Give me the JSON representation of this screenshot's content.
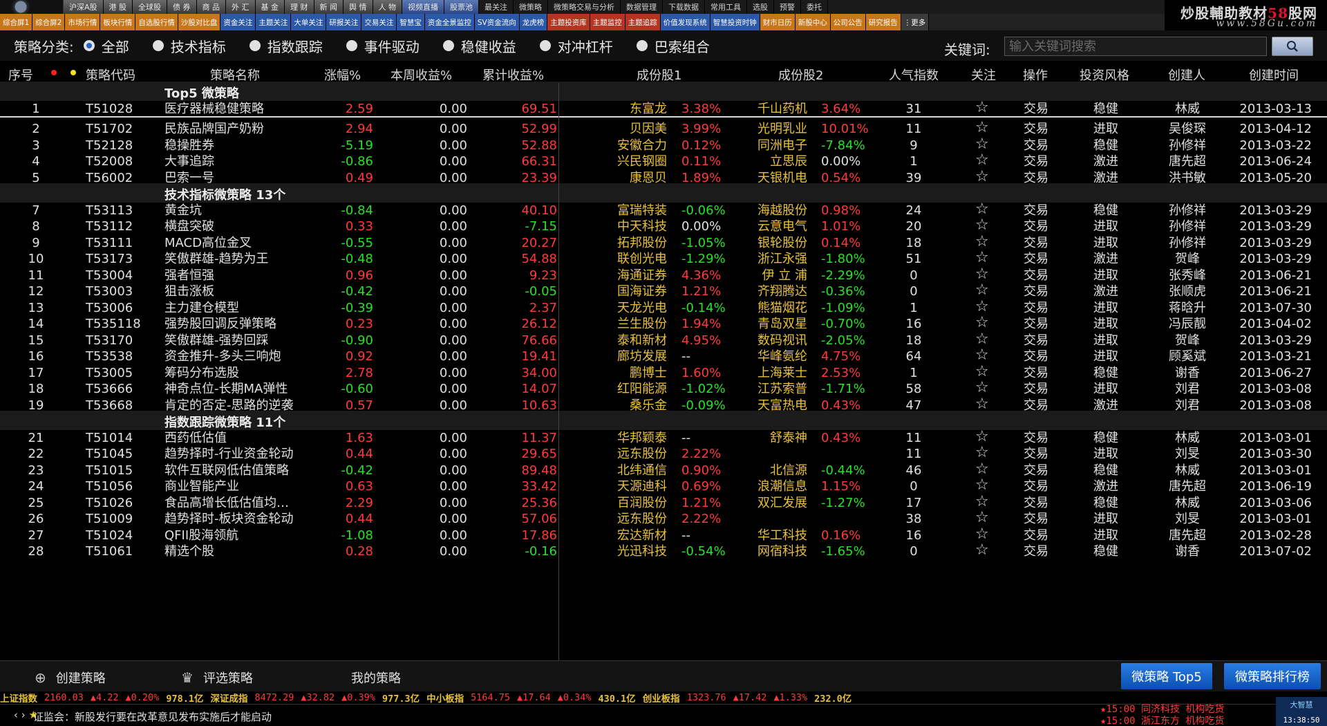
{
  "nav_top": [
    "沪深A股",
    "港 股",
    "全球股",
    "债 券",
    "商 品",
    "外 汇",
    "基 金",
    "理 财",
    "新 闻",
    "舆 情",
    "人 物",
    "视频直播",
    "股票池",
    "最关注",
    "微策略",
    "微策略交易与分析",
    "数据管理",
    "下载数据",
    "常用工具",
    "选股",
    "预警",
    "委托"
  ],
  "nav_second": [
    {
      "label": "综合屏1",
      "color": "or"
    },
    {
      "label": "综合屏2",
      "color": "or"
    },
    {
      "label": "市场行情",
      "color": "or"
    },
    {
      "label": "板块行情",
      "color": "or"
    },
    {
      "label": "自选股行情",
      "color": "or"
    },
    {
      "label": "沙股对比盘",
      "color": "or"
    },
    {
      "label": "资金关注",
      "color": "bl"
    },
    {
      "label": "主题关注",
      "color": "bl"
    },
    {
      "label": "大单关注",
      "color": "bl"
    },
    {
      "label": "研报关注",
      "color": "bl"
    },
    {
      "label": "交易关注",
      "color": "bl"
    },
    {
      "label": "智慧宝",
      "color": "bl"
    },
    {
      "label": "资金全景监控",
      "color": "bl"
    },
    {
      "label": "SV资金流向",
      "color": "bl"
    },
    {
      "label": "龙虎榜",
      "color": "bl"
    },
    {
      "label": "主题投资库",
      "color": "rd"
    },
    {
      "label": "主题监控",
      "color": "rd"
    },
    {
      "label": "主题追踪",
      "color": "rd"
    },
    {
      "label": "价值发现系统",
      "color": "bl"
    },
    {
      "label": "智慧投资时钟",
      "color": "bl"
    },
    {
      "label": "财市日历",
      "color": "or"
    },
    {
      "label": "新股中心",
      "color": "or"
    },
    {
      "label": "公司公告",
      "color": "or"
    },
    {
      "label": "研究报告",
      "color": "or"
    },
    {
      "label": "⋮更多",
      "color": "gy"
    }
  ],
  "brand": {
    "line1a": "炒股輔助教材",
    "line1b": "58",
    "line1c": "股网",
    "line2": "www.58Gu.com"
  },
  "filter": {
    "label": "策略分类:",
    "options": [
      "全部",
      "技术指标",
      "指数跟踪",
      "事件驱动",
      "稳健收益",
      "对冲杠杆",
      "巴索组合"
    ],
    "selected_index": 0,
    "keyword_label": "关键词:",
    "keyword_placeholder": "输入关键词搜索"
  },
  "columns": {
    "seq": "序号",
    "code": "策略代码",
    "name": "策略名称",
    "chg": "涨幅%",
    "week": "本周收益%",
    "total": "累计收益%",
    "stock1": "成份股1",
    "stock2": "成份股2",
    "pop": "人气指数",
    "follow": "关注",
    "op": "操作",
    "style": "投资风格",
    "creator": "创建人",
    "time": "创建时间"
  },
  "groups": [
    {
      "title": "Top5 微策略",
      "rows": [
        {
          "seq": "1",
          "code": "T51028",
          "name": "医疗器械稳健策略",
          "chg": "2.59",
          "week": "0.00",
          "total": "69.51",
          "s1": "东富龙",
          "s1p": "3.38%",
          "s2": "千山药机",
          "s2p": "3.64%",
          "pop": "31",
          "op": "交易",
          "style": "稳健",
          "creator": "林威",
          "time": "2013-03-13"
        },
        {
          "seq": "2",
          "code": "T51702",
          "name": "民族品牌国产奶粉",
          "chg": "2.94",
          "week": "0.00",
          "total": "52.99",
          "s1": "贝因美",
          "s1p": "3.99%",
          "s2": "光明乳业",
          "s2p": "10.01%",
          "pop": "11",
          "op": "交易",
          "style": "进取",
          "creator": "吴俊琛",
          "time": "2013-04-12"
        },
        {
          "seq": "3",
          "code": "T52128",
          "name": "稳操胜券",
          "chg": "-5.19",
          "week": "0.00",
          "total": "52.88",
          "s1": "安徽合力",
          "s1p": "0.12%",
          "s2": "同洲电子",
          "s2p": "-7.84%",
          "pop": "9",
          "op": "交易",
          "style": "稳健",
          "creator": "孙修祥",
          "time": "2013-03-22"
        },
        {
          "seq": "4",
          "code": "T52008",
          "name": "大事追踪",
          "chg": "-0.86",
          "week": "0.00",
          "total": "66.31",
          "s1": "兴民钢圈",
          "s1p": "0.11%",
          "s2": "立思辰",
          "s2p": "0.00%",
          "pop": "1",
          "op": "交易",
          "style": "激进",
          "creator": "唐先超",
          "time": "2013-06-24"
        },
        {
          "seq": "5",
          "code": "T56002",
          "name": "巴索一号",
          "chg": "0.49",
          "week": "0.00",
          "total": "23.39",
          "s1": "康恩贝",
          "s1p": "1.89%",
          "s2": "天银机电",
          "s2p": "0.54%",
          "pop": "39",
          "op": "交易",
          "style": "激进",
          "creator": "洪书敏",
          "time": "2013-05-20"
        }
      ]
    },
    {
      "title": "技术指标微策略 13个",
      "rows": [
        {
          "seq": "7",
          "code": "T53113",
          "name": "黄金坑",
          "chg": "-0.84",
          "week": "0.00",
          "total": "40.10",
          "s1": "富瑞特装",
          "s1p": "-0.06%",
          "s2": "海越股份",
          "s2p": "0.98%",
          "pop": "24",
          "op": "交易",
          "style": "稳健",
          "creator": "孙修祥",
          "time": "2013-03-29"
        },
        {
          "seq": "8",
          "code": "T53112",
          "name": "横盘突破",
          "chg": "0.33",
          "week": "0.00",
          "total": "-7.15",
          "s1": "中天科技",
          "s1p": "0.00%",
          "s2": "云意电气",
          "s2p": "1.01%",
          "pop": "20",
          "op": "交易",
          "style": "进取",
          "creator": "孙修祥",
          "time": "2013-03-29"
        },
        {
          "seq": "9",
          "code": "T53111",
          "name": "MACD高位金叉",
          "chg": "-0.55",
          "week": "0.00",
          "total": "20.27",
          "s1": "拓邦股份",
          "s1p": "-1.05%",
          "s2": "银轮股份",
          "s2p": "0.14%",
          "pop": "18",
          "op": "交易",
          "style": "进取",
          "creator": "孙修祥",
          "time": "2013-03-29"
        },
        {
          "seq": "10",
          "code": "T53173",
          "name": "笑傲群雄-趋势为王",
          "chg": "-0.48",
          "week": "0.00",
          "total": "54.88",
          "s1": "联创光电",
          "s1p": "-1.29%",
          "s2": "浙江永强",
          "s2p": "-1.80%",
          "pop": "51",
          "op": "交易",
          "style": "激进",
          "creator": "贺峰",
          "time": "2013-03-29"
        },
        {
          "seq": "11",
          "code": "T53004",
          "name": "强者恒强",
          "chg": "0.96",
          "week": "0.00",
          "total": "9.23",
          "s1": "海通证券",
          "s1p": "4.36%",
          "s2": "伊 立 浦",
          "s2p": "-2.29%",
          "pop": "0",
          "op": "交易",
          "style": "进取",
          "creator": "张秀峰",
          "time": "2013-06-21"
        },
        {
          "seq": "12",
          "code": "T53003",
          "name": "狙击涨板",
          "chg": "-0.42",
          "week": "0.00",
          "total": "-0.05",
          "s1": "国海证券",
          "s1p": "1.21%",
          "s2": "齐翔腾达",
          "s2p": "-0.36%",
          "pop": "0",
          "op": "交易",
          "style": "激进",
          "creator": "张顺虎",
          "time": "2013-06-21"
        },
        {
          "seq": "13",
          "code": "T53006",
          "name": "主力建仓模型",
          "chg": "-0.39",
          "week": "0.00",
          "total": "2.37",
          "s1": "天龙光电",
          "s1p": "-0.14%",
          "s2": "熊猫烟花",
          "s2p": "-1.09%",
          "pop": "1",
          "op": "交易",
          "style": "进取",
          "creator": "蒋晗升",
          "time": "2013-07-30"
        },
        {
          "seq": "14",
          "code": "T535118",
          "name": "强势股回调反弹策略",
          "chg": "0.23",
          "week": "0.00",
          "total": "26.12",
          "s1": "兰生股份",
          "s1p": "1.94%",
          "s2": "青岛双星",
          "s2p": "-0.70%",
          "pop": "16",
          "op": "交易",
          "style": "进取",
          "creator": "冯辰靓",
          "time": "2013-04-02"
        },
        {
          "seq": "15",
          "code": "T53170",
          "name": "笑傲群雄-强势回踩",
          "chg": "-0.90",
          "week": "0.00",
          "total": "76.66",
          "s1": "泰和新材",
          "s1p": "4.95%",
          "s2": "数码视讯",
          "s2p": "-2.05%",
          "pop": "18",
          "op": "交易",
          "style": "进取",
          "creator": "贺峰",
          "time": "2013-03-29"
        },
        {
          "seq": "16",
          "code": "T53538",
          "name": "资金推升-多头三响炮",
          "chg": "0.92",
          "week": "0.00",
          "total": "19.41",
          "s1": "廊坊发展",
          "s1p": "--",
          "s2": "华峰氨纶",
          "s2p": "4.75%",
          "pop": "64",
          "op": "交易",
          "style": "进取",
          "creator": "顾奚斌",
          "time": "2013-03-21"
        },
        {
          "seq": "17",
          "code": "T53005",
          "name": "筹码分布选股",
          "chg": "2.78",
          "week": "0.00",
          "total": "34.00",
          "s1": "鹏博士",
          "s1p": "1.60%",
          "s2": "上海莱士",
          "s2p": "2.53%",
          "pop": "1",
          "op": "交易",
          "style": "稳健",
          "creator": "谢香",
          "time": "2013-06-27"
        },
        {
          "seq": "18",
          "code": "T53666",
          "name": "神奇点位-长期MA弹性",
          "chg": "-0.60",
          "week": "0.00",
          "total": "14.07",
          "s1": "红阳能源",
          "s1p": "-1.02%",
          "s2": "江苏索普",
          "s2p": "-1.71%",
          "pop": "58",
          "op": "交易",
          "style": "进取",
          "creator": "刘君",
          "time": "2013-03-08"
        },
        {
          "seq": "19",
          "code": "T53668",
          "name": "肯定的否定-思路的逆袭",
          "chg": "0.57",
          "week": "0.00",
          "total": "10.63",
          "s1": "桑乐金",
          "s1p": "-0.09%",
          "s2": "天富热电",
          "s2p": "0.43%",
          "pop": "47",
          "op": "交易",
          "style": "激进",
          "creator": "刘君",
          "time": "2013-03-08"
        }
      ]
    },
    {
      "title": "指数跟踪微策略 11个",
      "rows": [
        {
          "seq": "21",
          "code": "T51014",
          "name": "西药低估值",
          "chg": "1.63",
          "week": "0.00",
          "total": "11.37",
          "s1": "华邦颖泰",
          "s1p": "--",
          "s2": "舒泰神",
          "s2p": "0.43%",
          "pop": "11",
          "op": "交易",
          "style": "稳健",
          "creator": "林威",
          "time": "2013-03-01"
        },
        {
          "seq": "22",
          "code": "T51045",
          "name": "趋势择时-行业资金轮动",
          "chg": "0.44",
          "week": "0.00",
          "total": "29.65",
          "s1": "远东股份",
          "s1p": "2.22%",
          "s2": "",
          "s2p": "",
          "pop": "11",
          "op": "交易",
          "style": "进取",
          "creator": "刘旻",
          "time": "2013-03-30"
        },
        {
          "seq": "23",
          "code": "T51015",
          "name": "软件互联网低估值策略",
          "chg": "-0.42",
          "week": "0.00",
          "total": "89.48",
          "s1": "北纬通信",
          "s1p": "0.90%",
          "s2": "北信源",
          "s2p": "-0.44%",
          "pop": "46",
          "op": "交易",
          "style": "稳健",
          "creator": "林威",
          "time": "2013-03-01"
        },
        {
          "seq": "24",
          "code": "T51056",
          "name": "商业智能产业",
          "chg": "0.63",
          "week": "0.00",
          "total": "33.42",
          "s1": "天源迪科",
          "s1p": "0.69%",
          "s2": "浪潮信息",
          "s2p": "1.15%",
          "pop": "0",
          "op": "交易",
          "style": "激进",
          "creator": "唐先超",
          "time": "2013-06-19"
        },
        {
          "seq": "25",
          "code": "T51026",
          "name": "食品高增长低估值均…",
          "chg": "2.29",
          "week": "0.00",
          "total": "25.36",
          "s1": "百润股份",
          "s1p": "1.21%",
          "s2": "双汇发展",
          "s2p": "-1.27%",
          "pop": "17",
          "op": "交易",
          "style": "稳健",
          "creator": "林威",
          "time": "2013-03-06"
        },
        {
          "seq": "26",
          "code": "T51009",
          "name": "趋势择时-板块资金轮动",
          "chg": "0.44",
          "week": "0.00",
          "total": "57.06",
          "s1": "远东股份",
          "s1p": "2.22%",
          "s2": "",
          "s2p": "",
          "pop": "38",
          "op": "交易",
          "style": "进取",
          "creator": "刘旻",
          "time": "2013-03-01"
        },
        {
          "seq": "27",
          "code": "T51024",
          "name": "QFII股海领航",
          "chg": "-1.08",
          "week": "0.00",
          "total": "17.86",
          "s1": "宏达新材",
          "s1p": "--",
          "s2": "华工科技",
          "s2p": "0.16%",
          "pop": "16",
          "op": "交易",
          "style": "进取",
          "creator": "唐先超",
          "time": "2013-02-28"
        },
        {
          "seq": "28",
          "code": "T51061",
          "name": "精选个股",
          "chg": "0.28",
          "week": "0.00",
          "total": "-0.16",
          "s1": "光迅科技",
          "s1p": "-0.54%",
          "s2": "网宿科技",
          "s2p": "-1.65%",
          "pop": "0",
          "op": "交易",
          "style": "稳健",
          "creator": "谢香",
          "time": "2013-07-02"
        }
      ]
    }
  ],
  "toolbar": {
    "create": "创建策略",
    "review": "评选策略",
    "mine": "我的策略",
    "top5": "微策略 Top5",
    "rank": "微策略排行榜"
  },
  "ticker": [
    {
      "t": "上证指数",
      "c": "yel"
    },
    {
      "t": "2160.03",
      "c": "red"
    },
    {
      "t": "▲4.22",
      "c": "red"
    },
    {
      "t": "▲0.20%",
      "c": "red"
    },
    {
      "t": "978.1亿",
      "c": "yel"
    },
    {
      "t": "深证成指",
      "c": "yel"
    },
    {
      "t": "8472.29",
      "c": "red"
    },
    {
      "t": "▲32.82",
      "c": "red"
    },
    {
      "t": "▲0.39%",
      "c": "red"
    },
    {
      "t": "977.3亿",
      "c": "yel"
    },
    {
      "t": "中小板指",
      "c": "yel"
    },
    {
      "t": "5164.75",
      "c": "red"
    },
    {
      "t": "▲17.64",
      "c": "red"
    },
    {
      "t": "▲0.34%",
      "c": "red"
    },
    {
      "t": "430.1亿",
      "c": "yel"
    },
    {
      "t": "创业板指",
      "c": "yel"
    },
    {
      "t": "1323.76",
      "c": "red"
    },
    {
      "t": "▲17.42",
      "c": "red"
    },
    {
      "t": "▲1.33%",
      "c": "red"
    },
    {
      "t": "232.0亿",
      "c": "yel"
    }
  ],
  "news": "证监会：新股发行要在改革意见发布实施后才能启动",
  "alerts": [
    "★15:00 同济科技 机构吃货",
    "★15:00 浙江东方 机构吃货"
  ],
  "clock": {
    "app": "大智慧",
    "time": "13:38:50"
  },
  "colors": {
    "up": "#ff3a3a",
    "down": "#26e226",
    "accent": "#2463c8",
    "stock": "#e8c03a"
  }
}
